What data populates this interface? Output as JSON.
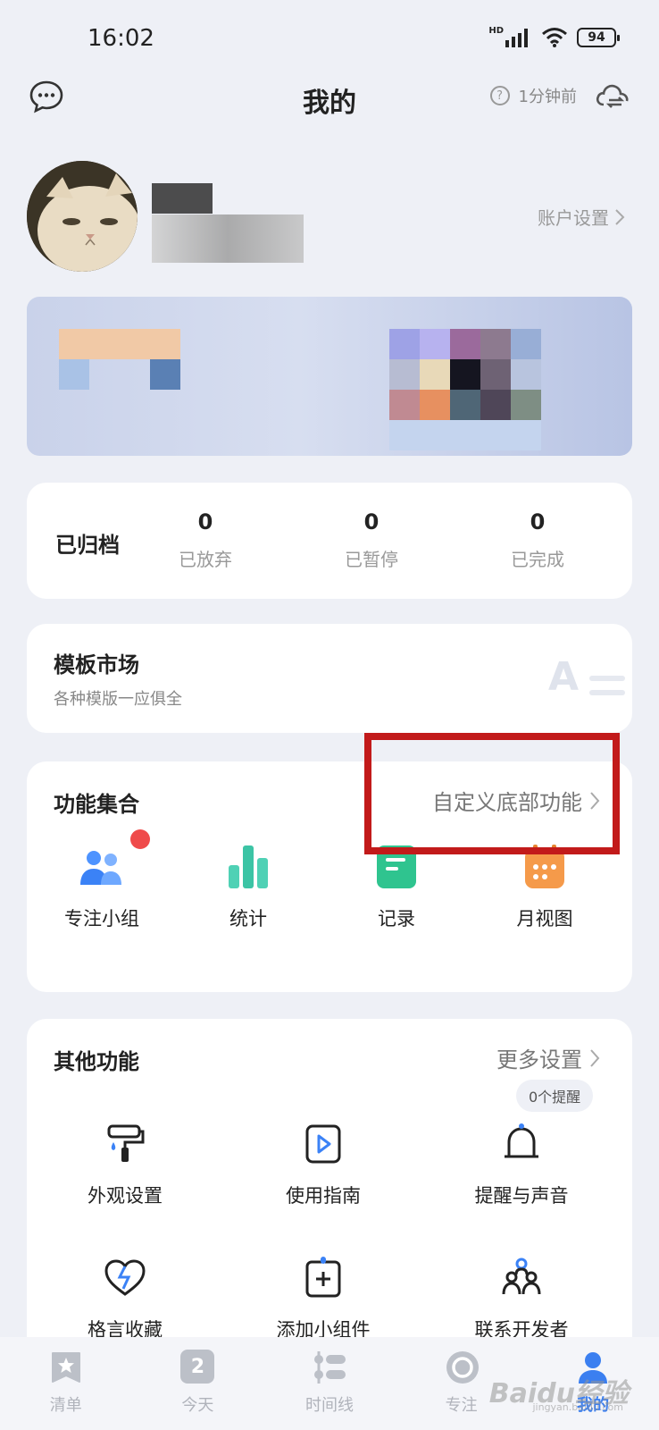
{
  "status_bar": {
    "time": "16:02",
    "network": "HD",
    "battery": "94"
  },
  "header": {
    "title": "我的",
    "sync_time": "1分钟前",
    "help": "?"
  },
  "profile": {
    "account_settings": "账户设置"
  },
  "archive": {
    "title": "已归档",
    "stats": [
      {
        "value": "0",
        "label": "已放弃"
      },
      {
        "value": "0",
        "label": "已暂停"
      },
      {
        "value": "0",
        "label": "已完成"
      }
    ]
  },
  "template_market": {
    "title": "模板市场",
    "subtitle": "各种模版一应俱全",
    "decor": "A"
  },
  "features": {
    "title": "功能集合",
    "customize": "自定义底部功能",
    "items": [
      {
        "label": "专注小组",
        "icon": "people-icon"
      },
      {
        "label": "统计",
        "icon": "bar-chart-icon"
      },
      {
        "label": "记录",
        "icon": "note-icon"
      },
      {
        "label": "月视图",
        "icon": "calendar-icon"
      }
    ]
  },
  "other": {
    "title": "其他功能",
    "more": "更多设置",
    "remind_badge": "0个提醒",
    "items": [
      {
        "label": "外观设置",
        "icon": "paint-roller-icon"
      },
      {
        "label": "使用指南",
        "icon": "play-guide-icon"
      },
      {
        "label": "提醒与声音",
        "icon": "bell-icon"
      },
      {
        "label": "格言收藏",
        "icon": "heart-icon"
      },
      {
        "label": "添加小组件",
        "icon": "add-widget-icon"
      },
      {
        "label": "联系开发者",
        "icon": "team-icon"
      }
    ]
  },
  "bottom_nav": {
    "items": [
      {
        "label": "清单",
        "icon": "star-icon"
      },
      {
        "label": "今天",
        "icon": "calendar-day-icon",
        "day": "2"
      },
      {
        "label": "时间线",
        "icon": "timeline-icon"
      },
      {
        "label": "专注",
        "icon": "focus-icon"
      },
      {
        "label": "我的",
        "icon": "person-icon",
        "active": true
      }
    ]
  },
  "watermark": {
    "brand": "Baidu经验",
    "url": "jingyan.baidu.com"
  },
  "colors": {
    "accent": "#3b7ff0",
    "highlight_box": "#c21a1a",
    "background": "#eef0f6"
  }
}
